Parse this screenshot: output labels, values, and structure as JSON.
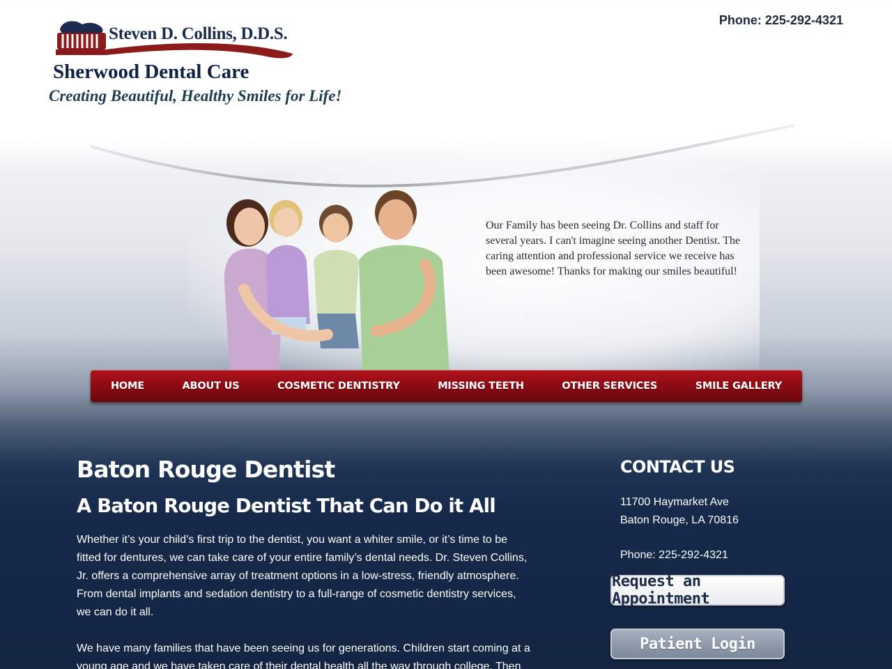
{
  "header": {
    "doctor_name": "Steven D. Collins, D.D.S.",
    "practice_name": "Sherwood Dental Care",
    "tagline": "Creating Beautiful, Healthy Smiles for Life!",
    "phone": "Phone: 225-292-4321"
  },
  "hero": {
    "testimonial": "Our Family has been seeing Dr. Collins and staff for several years. I can't imagine seeing another Dentist. The caring attention and professional service we receive has been awesome! Thanks for making our smiles beautiful!",
    "image": "family-photo"
  },
  "nav": {
    "items": [
      {
        "label": "HOME"
      },
      {
        "label": "ABOUT US"
      },
      {
        "label": "COSMETIC DENTISTRY"
      },
      {
        "label": "MISSING TEETH"
      },
      {
        "label": "OTHER SERVICES"
      },
      {
        "label": "SMILE GALLERY"
      }
    ]
  },
  "main": {
    "title": "Baton Rouge Dentist",
    "subtitle": "A Baton Rouge Dentist That Can Do it All",
    "paragraphs": [
      "Whether it’s your child’s first trip to the dentist, you want a whiter smile, or it’s time to be fitted for dentures, we can take care of your entire family’s dental needs. Dr. Steven Collins, Jr. offers a comprehensive array of treatment options in a low-stress, friendly atmosphere. From dental implants and sedation dentistry to a full-range of cosmetic dentistry services, we can do it all.",
      "We have many families that have been seeing us for generations. Children start coming at a young age and we have taken care of their dental health all the way through college. Then"
    ]
  },
  "contact": {
    "title": "CONTACT US",
    "address_line1": "11700 Haymarket Ave",
    "address_line2": "Baton Rouge, LA 70816",
    "phone": "Phone: 225-292-4321",
    "appointment_button": "Request an Appointment",
    "login_button": "Patient Login"
  },
  "colors": {
    "nav_red": "#8d0c14",
    "navy": "#16294a",
    "brush_red": "#8b1a1a",
    "brush_blue": "#1b2a4e"
  }
}
